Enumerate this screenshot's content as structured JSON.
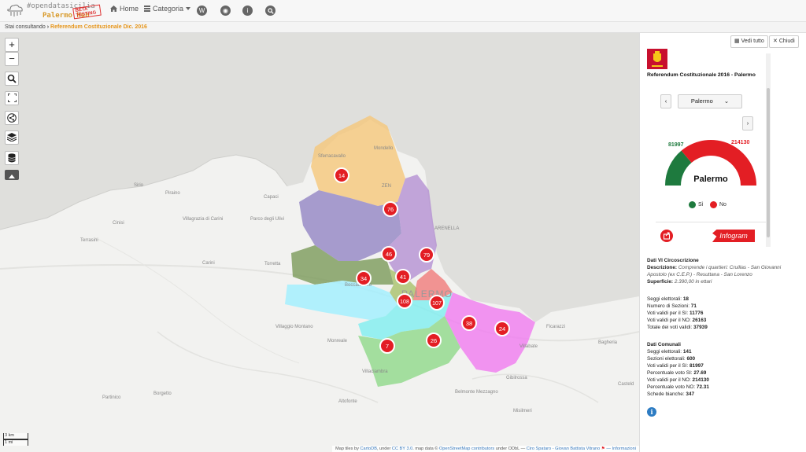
{
  "brand": {
    "line1": "#opendatasicilia",
    "line2": "Palermo Hub",
    "beta": "BETA TESTING"
  },
  "nav": {
    "home": "Home",
    "categoria": "Categoria",
    "w": "W"
  },
  "breadcrumb": {
    "prefix": "Stai consultando",
    "current": "Referendum Costituzionale Dic. 2016"
  },
  "map": {
    "towns": [
      "Capaci",
      "Sferracavallo",
      "Mondello",
      "Sirio",
      "Piraino",
      "Villagrazia di Carini",
      "Carini",
      "Parco degli Ulivi",
      "Terrasini",
      "Cinisi",
      "Torretta",
      "Boccadifalco",
      "Villaggio Montano",
      "Monreale",
      "Villaciambra",
      "Borgetto",
      "Partinico",
      "Altofonte",
      "Belmonte Mezzagno",
      "Misilmeri",
      "Ficarazzi",
      "Villabate",
      "Bagheria",
      "Casteld",
      "Gibilrossa",
      "ZEN",
      "ARENELLA"
    ],
    "city_label": "PALERMO",
    "markers": [
      "14",
      "76",
      "46",
      "79",
      "34",
      "41",
      "108",
      "107",
      "38",
      "24",
      "7",
      "26"
    ],
    "scale": {
      "km": "3 km",
      "mi": "1 mi"
    },
    "attribution": {
      "pre": "Map tiles by",
      "carto": "CartoDB",
      "under": ", under",
      "ccby": "CC BY 3.0",
      "mapdata": ". map data ©",
      "osm": "OpenStreetMap contributors",
      "odbl": "under ODbL —",
      "authors": "Ciro Spataro - Giovan Battista Vitrano",
      "info": "— Informazioni"
    }
  },
  "panel": {
    "vedi_tutto": "Vedi tutto",
    "chiudi": "Chiudi",
    "title": "Referendum Costituzionale 2016 - Palermo",
    "select": "Palermo",
    "gauge": {
      "center_label": "Palermo",
      "si_value": "81997",
      "no_value": "214130",
      "si_share": 0.2769,
      "si_color": "#1e7a3e",
      "no_color": "#e31e24"
    },
    "legend": {
      "si": "Sì",
      "no": "No"
    },
    "infogram": "Infogram",
    "circ": {
      "heading": "Dati VI Circoscrizione",
      "desc_label": "Descrizione:",
      "desc_value": "Comprende i quartieri: Cruillas - San Giovanni Apostolo (ex C.E.P.) - Resuttana - San Lorenzo",
      "sup_label": "Superficie:",
      "sup_value": "2.390,00 in ettari",
      "seggi_label": "Seggi elettorali:",
      "seggi": "18",
      "sezioni_label": "Numero di Sezioni:",
      "sezioni": "71",
      "si_label": "Voti validi per il SI:",
      "si": "11776",
      "no_label": "Voti validi per il NO:",
      "no": "26163",
      "tot_label": "Totale dei voti validi:",
      "tot": "37939"
    },
    "comunali": {
      "heading": "Dati Comunali",
      "seggi_label": "Seggi elettorali:",
      "seggi": "141",
      "sezioni_label": "Sezioni elettorali:",
      "sezioni": "600",
      "si_label": "Voti validi per il SI:",
      "si": "81997",
      "psi_label": "Percentuale voto SI:",
      "psi": "27.69",
      "no_label": "Voti validi per il NO:",
      "no": "214130",
      "pno_label": "Percentuale voto NO:",
      "pno": "72.31",
      "bianche_label": "Schede bianche:",
      "bianche": "347"
    }
  },
  "colors": {
    "marker": "#e31e24",
    "accent": "#e69417"
  }
}
